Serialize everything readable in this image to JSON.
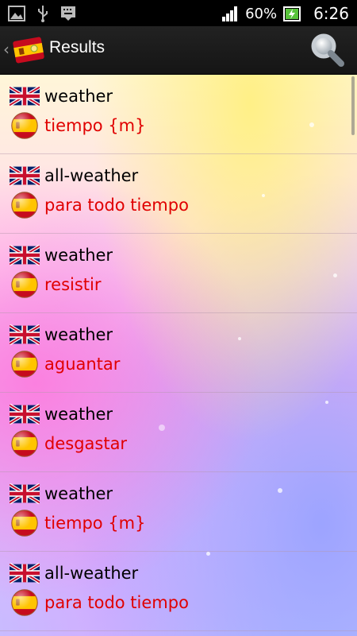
{
  "status_bar": {
    "battery_percent": "60%",
    "time": "6:26",
    "icons": [
      "image-icon",
      "usb-icon",
      "keyboard-icon",
      "signal-icon",
      "battery-charging-icon"
    ]
  },
  "action_bar": {
    "title": "Results",
    "logo": "spain-dictionary-logo",
    "search_icon": "search-icon"
  },
  "results": [
    {
      "term": "weather",
      "translation": "tiempo {m}"
    },
    {
      "term": "all-weather",
      "translation": "para todo tiempo"
    },
    {
      "term": "weather",
      "translation": "resistir"
    },
    {
      "term": "weather",
      "translation": "aguantar"
    },
    {
      "term": "weather",
      "translation": "desgastar"
    },
    {
      "term": "weather",
      "translation": "tiempo {m}"
    },
    {
      "term": "all-weather",
      "translation": "para todo tiempo"
    }
  ],
  "colors": {
    "term": "#000000",
    "translation": "#e00000",
    "action_bar": "#1a1a1a",
    "status_bar": "#000000"
  }
}
